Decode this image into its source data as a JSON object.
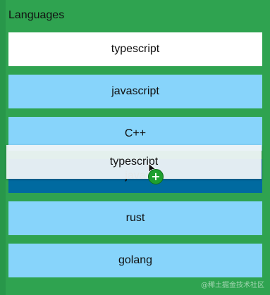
{
  "page": {
    "title": "Languages"
  },
  "list": {
    "items": [
      {
        "label": "typescript",
        "state": "being-dragged-source"
      },
      {
        "label": "javascript"
      },
      {
        "label": "C++"
      },
      {
        "label": "java",
        "state": "drop-target"
      },
      {
        "label": "rust"
      },
      {
        "label": "golang"
      }
    ]
  },
  "drag": {
    "ghost_label": "typescript",
    "badge_symbol": "+"
  },
  "watermark": "@稀土掘金技术社区",
  "colors": {
    "background": "#2fa350",
    "item": "#87d4fb",
    "dragged_source": "#ffffff",
    "drop_target": "#006aa0"
  }
}
